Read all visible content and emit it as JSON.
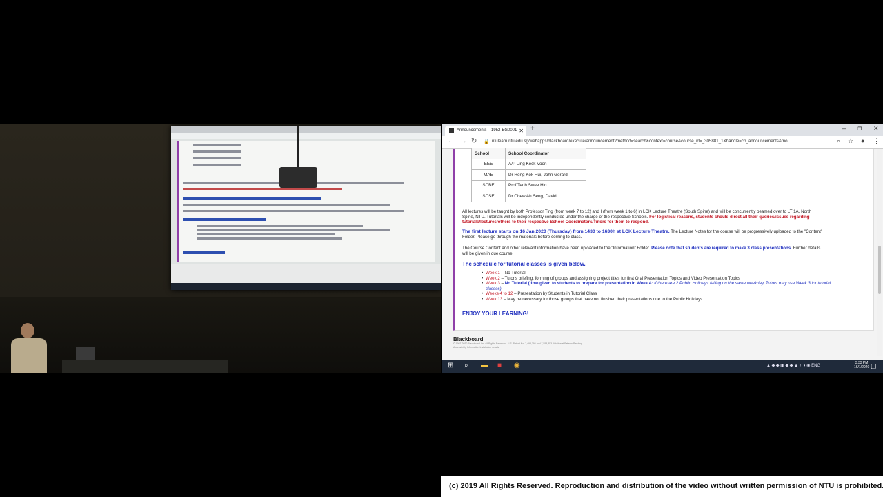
{
  "browser": {
    "tab_title": "Announcements – 1952-EG0001",
    "tab_close": "✕",
    "new_tab": "+",
    "window_controls": [
      "–",
      "❐",
      "✕"
    ],
    "url": "ntulearn.ntu.edu.sg/webapps/blackboard/execute/announcement?method=search&context=course&course_id=_305881_1&handle=cp_announcements&mo..."
  },
  "coordinators": {
    "headers": [
      "School",
      "School Coordinator"
    ],
    "rows": [
      [
        "EEE",
        "A/P Ling Keck Voon"
      ],
      [
        "MAE",
        "Dr Heng Kok Hui, John Gerard"
      ],
      [
        "SCBE",
        "Prof Teoh Swee Hin"
      ],
      [
        "SCSE",
        "Dr Chew Ah Seng, David"
      ]
    ]
  },
  "announcement": {
    "p1_text": "All lectures will be taught by both Professor Ting (from week 7 to 12) and I (from week 1 to 6) in LCK Lecture Theatre (South Spine) and will be concurrently beamed over to LT 1A, North Spine, NTU.  Tutorials will be independently conducted under the charge of the respective Schools.",
    "p1_red": "For logistical reasons, students should direct all their queries/issues regarding tutorials/lectures/others to their respective School Coordinators/Tutors for them to respond.",
    "p2_blue": "The first lecture starts on 16 Jan 2020 (Thursday) from 1430 to 1630h at LCK Lecture Theatre.",
    "p2_text": "The Lecture Notes for the course will be progressively uploaded to the \"Content\" Folder. Please go through the materials before coming to class.",
    "p3_text": "The Course Content and other relevant information have been uploaded to the \"Information\" Folder.",
    "p3_blue": "Please note that students are required to make 3 class presentations.",
    "p3_tail": "Further details will be given in due course.",
    "schedule_heading": "The schedule for tutorial classes is given below.",
    "schedule": [
      {
        "week": "Week 1",
        "text": " – No Tutorial"
      },
      {
        "week": "Week 2",
        "text": " – Tutor's briefing, forming of groups and assigning project titles for first Oral Presentation Topics and Video Presentation Topics"
      },
      {
        "week": "Week 3",
        "text": " – "
      },
      {
        "week": "Weeks 4 to 12",
        "text": " – Presentation by Students in Tutorial Class"
      },
      {
        "week": "Week 13",
        "text": " – May be necessary for those groups that have not finished their presentations due to the Public Holidays"
      }
    ],
    "week3_blue": "No Tutorial (time given to students to prepare for presentation in Week 4:",
    "week3_italic": "If there are 2 Public Holidays falling on the same weekday, Tutors may use Week 3 for tutorial classes)",
    "closing": "ENJOY YOUR LEARNING!"
  },
  "footer": {
    "brand": "Blackboard",
    "legal": "© 1997-2020 Blackboard Inc. All Rights Reserved. U.S. Patent No. 7,493,396 and 7,558,853. Additional Patents Pending.",
    "links": "Accessibility Information    Installation details"
  },
  "taskbar": {
    "tray_lang": "ENG",
    "time": "3:33 PM",
    "date": "16/1/2020"
  },
  "copyright": "(c) 2019 All Rights Reserved. Reproduction and distribution of the video without written permission of NTU is prohibited."
}
